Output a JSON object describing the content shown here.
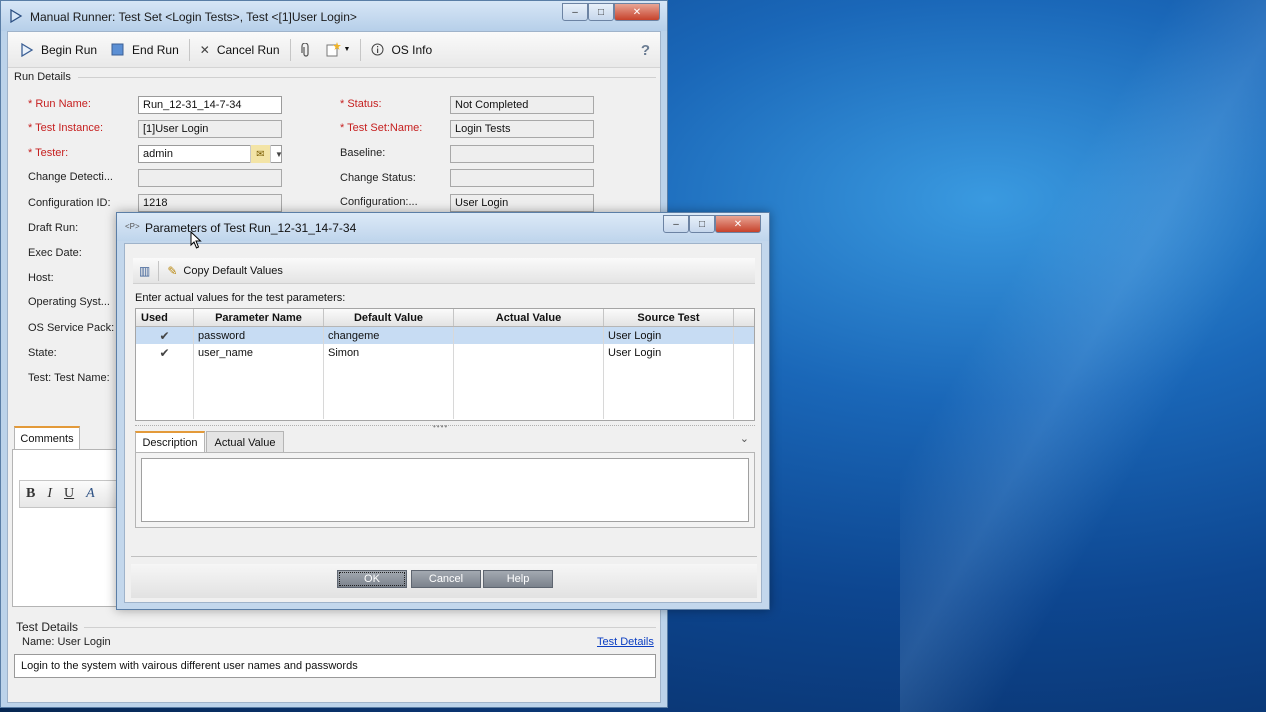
{
  "main_window": {
    "title": "Manual Runner: Test Set <Login Tests>, Test <[1]User Login>",
    "window_buttons": {
      "minimize": "–",
      "maximize": "□",
      "close": "✕"
    },
    "toolbar": {
      "begin_run": "Begin Run",
      "end_run": "End Run",
      "cancel_run": "Cancel Run",
      "os_info": "OS Info",
      "help": "?"
    },
    "run_details": {
      "section_title": "Run Details",
      "run_name_label": "* Run Name:",
      "run_name_value": "Run_12-31_14-7-34",
      "test_instance_label": "* Test Instance:",
      "test_instance_value": "[1]User Login",
      "tester_label": "* Tester:",
      "tester_value": "admin",
      "change_detection_label": "Change Detecti...",
      "change_detection_value": "",
      "configuration_id_label": "Configuration ID:",
      "configuration_id_value": "1218",
      "draft_run_label": "Draft Run:",
      "exec_date_label": "Exec Date:",
      "host_label": "Host:",
      "operating_system_label": "Operating Syst...",
      "os_service_pack_label": "OS Service Pack:",
      "state_label": "State:",
      "test_name_label": "Test: Test Name:",
      "status_label": "* Status:",
      "status_value": "Not Completed",
      "test_set_name_label": "* Test Set:Name:",
      "test_set_name_value": "Login Tests",
      "baseline_label": "Baseline:",
      "baseline_value": "",
      "change_status_label": "Change Status:",
      "change_status_value": "",
      "configuration_label": "Configuration:...",
      "configuration_value": "User Login"
    },
    "comments": {
      "tab_label": "Comments",
      "bold": "B",
      "italic": "I",
      "underline": "U",
      "font_color": "A"
    },
    "test_details": {
      "section_title": "Test Details",
      "name_line": "Name: User Login",
      "link": "Test Details",
      "description": "Login to the system with vairous different user names and passwords"
    }
  },
  "dialog": {
    "title": "Parameters of Test Run_12-31_14-7-34",
    "title_icon_text": "<P>",
    "toolbar": {
      "copy_default_values": "Copy Default Values"
    },
    "instruction": "Enter actual values for the test parameters:",
    "columns": [
      "Used",
      "Parameter Name",
      "Default Value",
      "Actual Value",
      "Source Test"
    ],
    "rows": [
      {
        "used": "✔",
        "name": "password",
        "default": "changeme",
        "actual": "",
        "source": "User Login"
      },
      {
        "used": "✔",
        "name": "user_name",
        "default": "Simon",
        "actual": "",
        "source": "User Login"
      }
    ],
    "tabs": {
      "description": "Description",
      "actual_value": "Actual Value"
    },
    "buttons": {
      "ok": "OK",
      "cancel": "Cancel",
      "help": "Help"
    }
  },
  "colors": {
    "required_label": "#c62020",
    "link": "#0b3ec2",
    "selected_row": "#c7dcf3",
    "active_tab_accent": "#e39a3a",
    "desktop": "#0d4690"
  }
}
